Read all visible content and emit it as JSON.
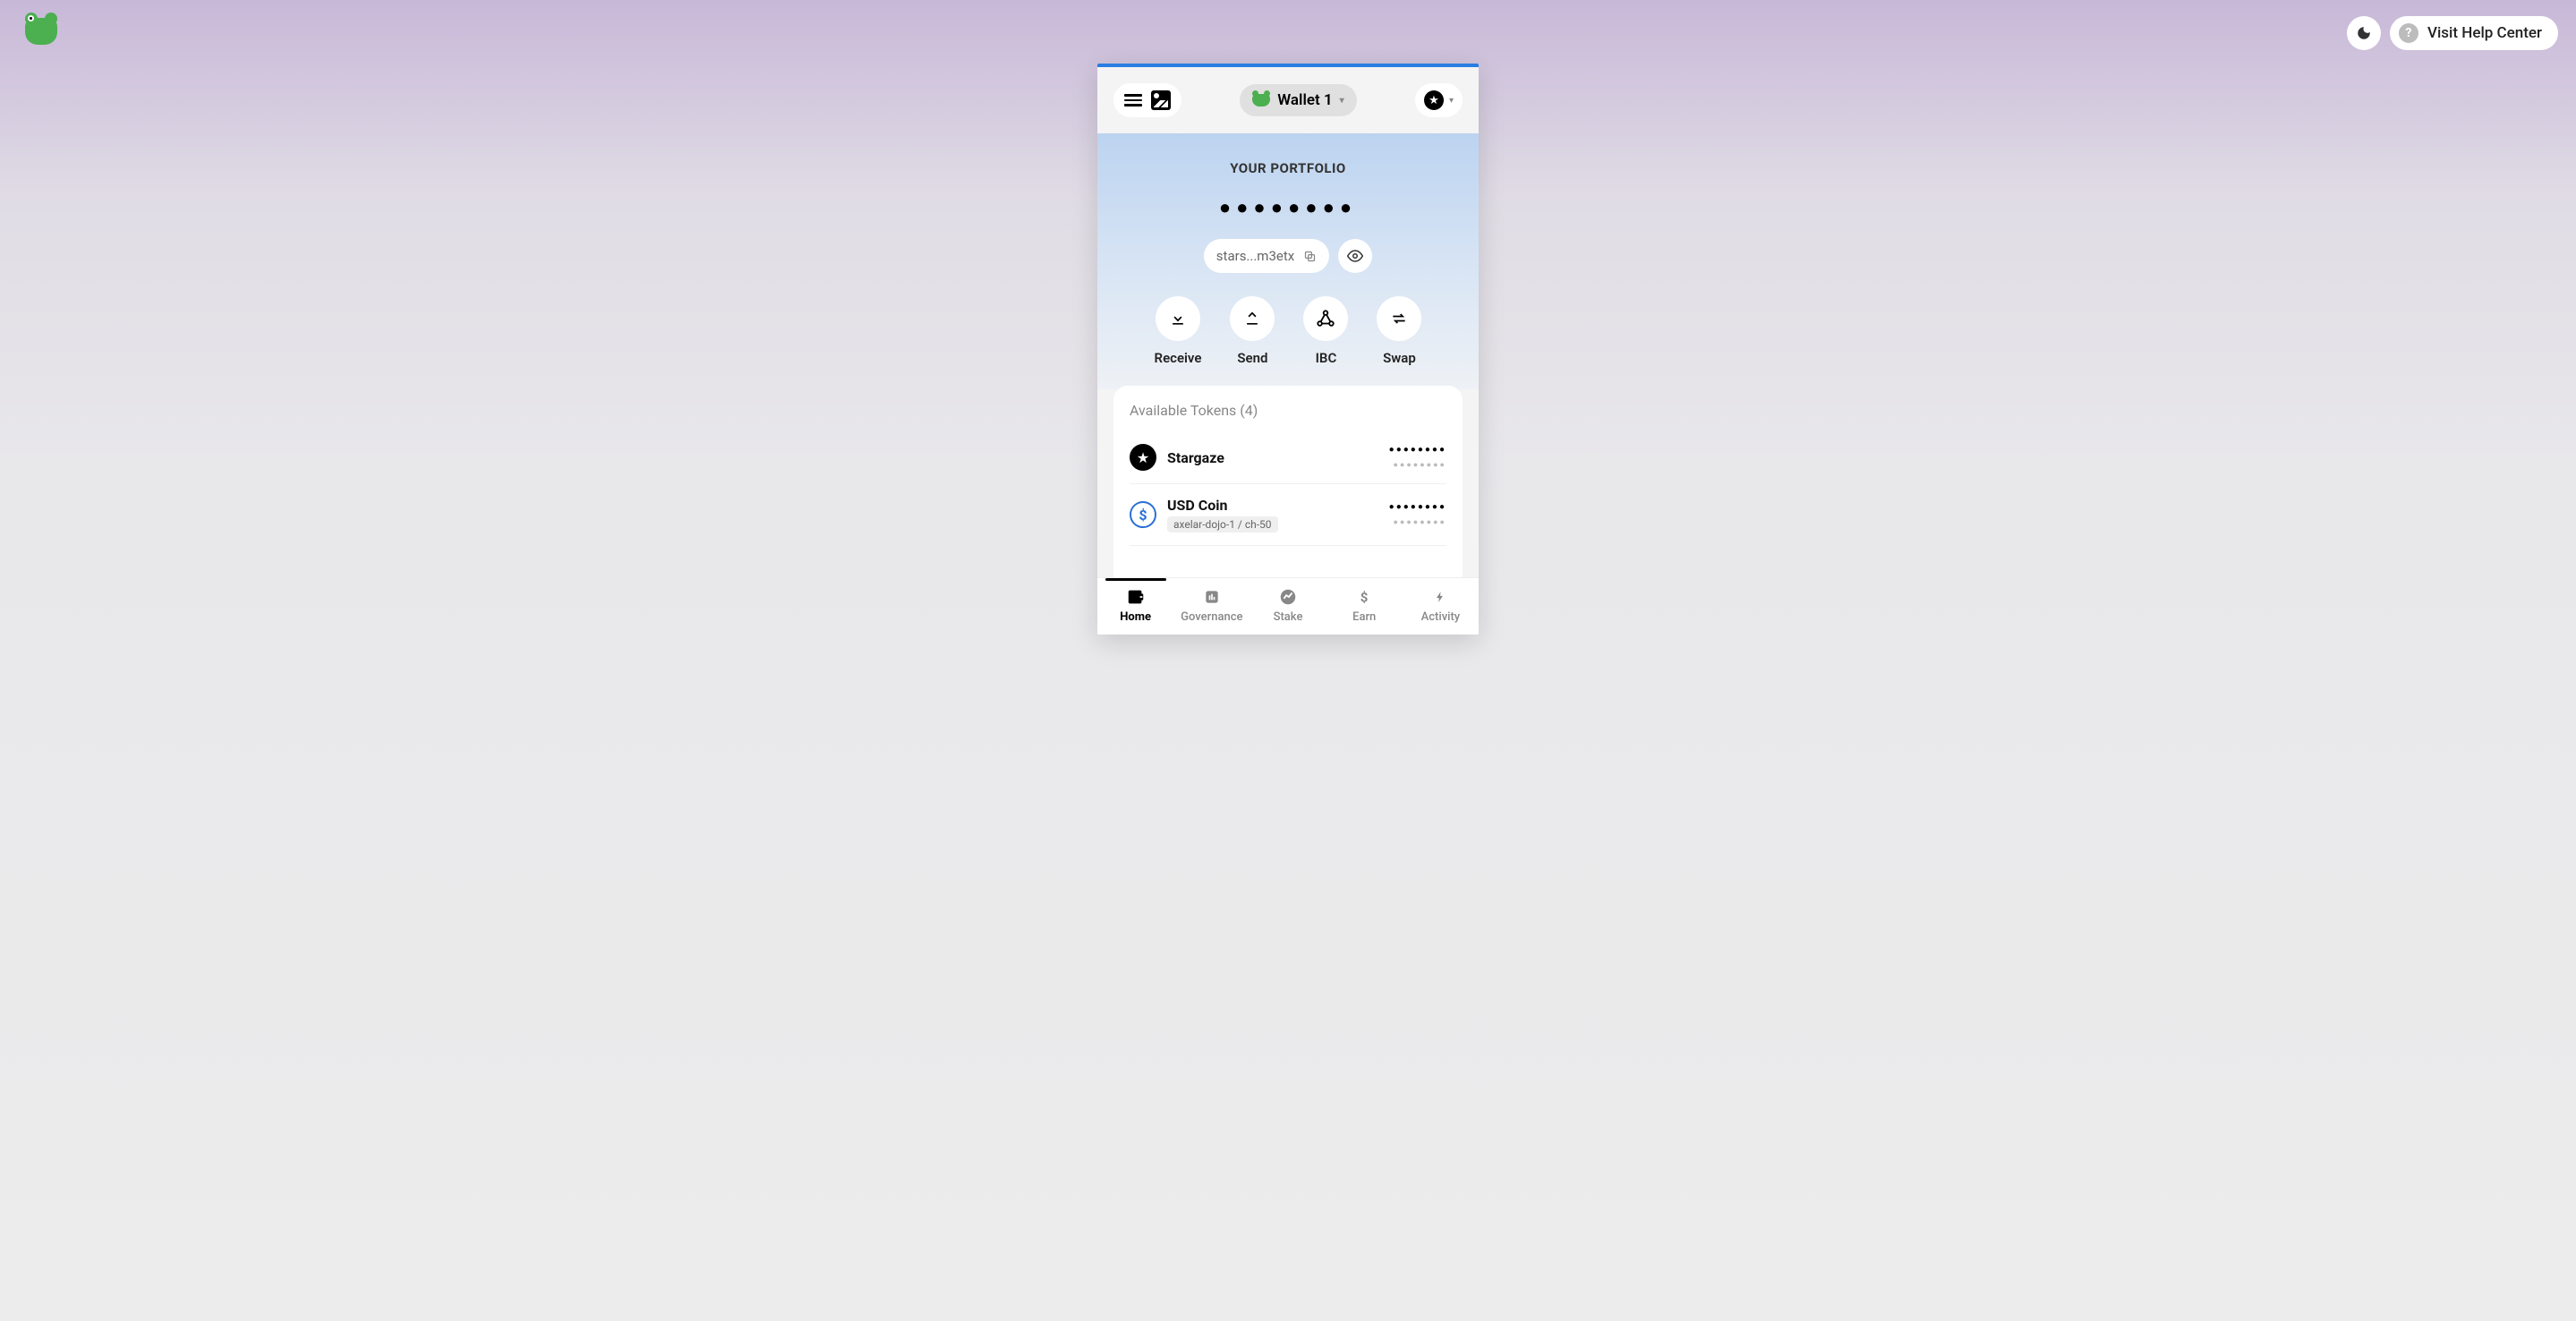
{
  "topbar": {
    "help_label": "Visit Help Center"
  },
  "wallet": {
    "name": "Wallet 1"
  },
  "portfolio": {
    "label": "YOUR PORTFOLIO",
    "balance_masked": "●●●●●●●●",
    "address": "stars...m3etx"
  },
  "actions": {
    "receive": "Receive",
    "send": "Send",
    "ibc": "IBC",
    "swap": "Swap"
  },
  "tokens_header": "Available Tokens (4)",
  "tokens": [
    {
      "name": "Stargaze",
      "tag": "",
      "v1": "●●●●●●●●",
      "v2": "●●●●●●●●"
    },
    {
      "name": "USD Coin",
      "tag": "axelar-dojo-1 / ch-50",
      "v1": "●●●●●●●●",
      "v2": "●●●●●●●●"
    }
  ],
  "nav": {
    "home": "Home",
    "governance": "Governance",
    "stake": "Stake",
    "earn": "Earn",
    "activity": "Activity"
  }
}
